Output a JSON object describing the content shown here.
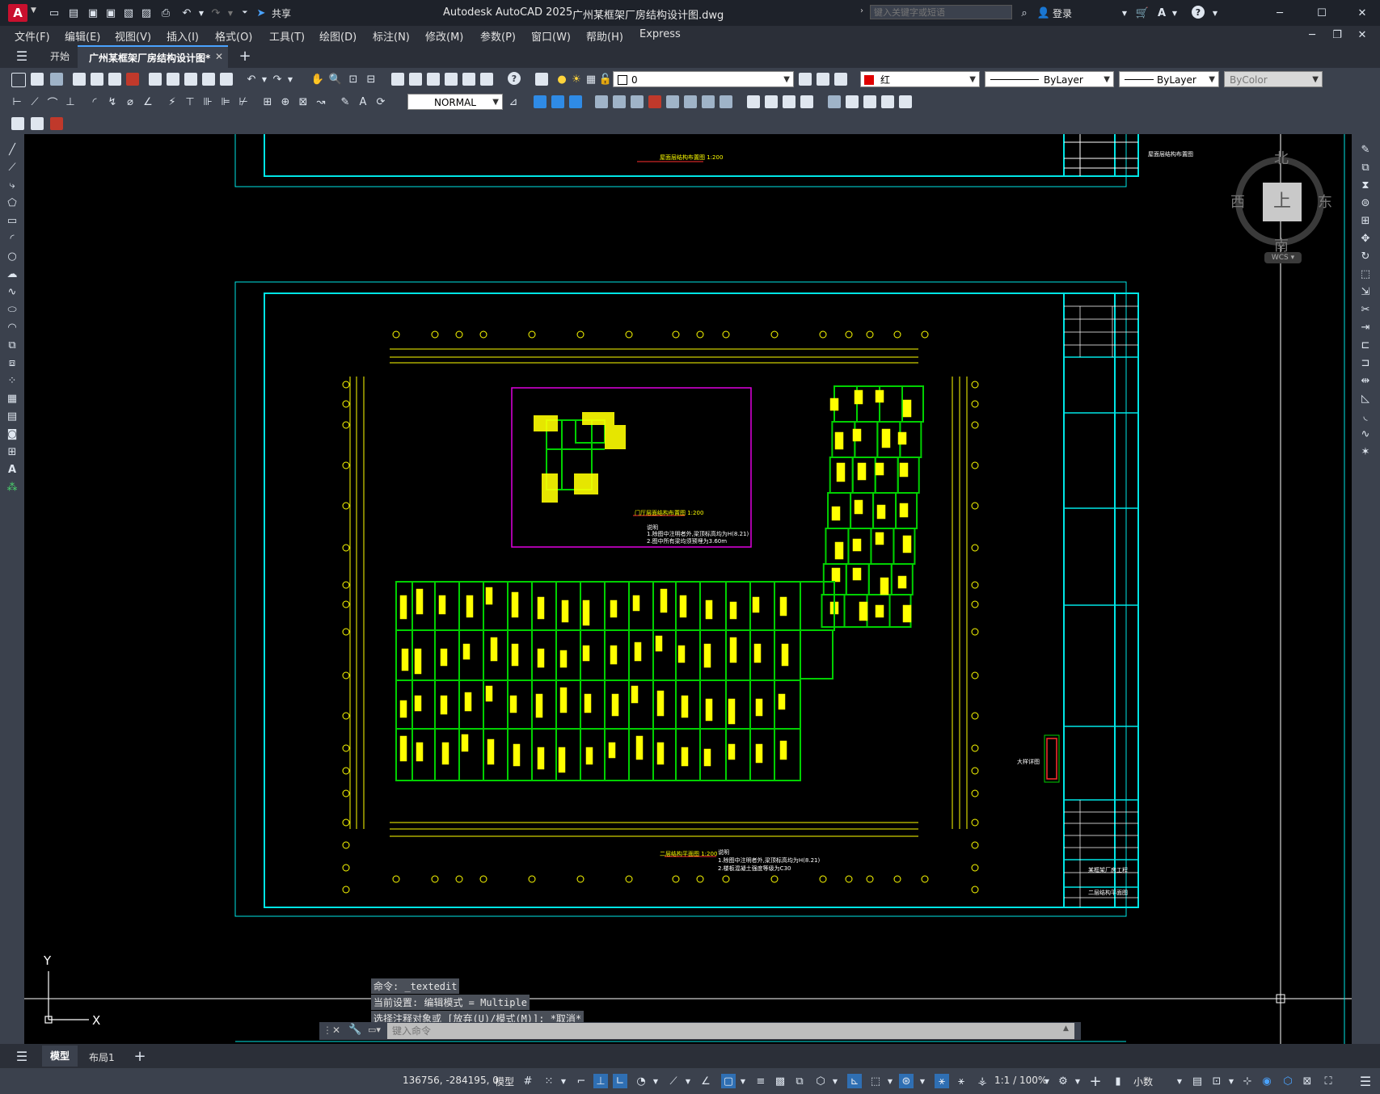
{
  "titlebar": {
    "app_title": "Autodesk AutoCAD 2025",
    "file_name": "广州某框架厂房结构设计图.dwg",
    "share_label": "共享",
    "search_placeholder": "键入关键字或短语",
    "login_label": "登录"
  },
  "menu": [
    "文件(F)",
    "编辑(E)",
    "视图(V)",
    "插入(I)",
    "格式(O)",
    "工具(T)",
    "绘图(D)",
    "标注(N)",
    "修改(M)",
    "参数(P)",
    "窗口(W)",
    "帮助(H)",
    "Express"
  ],
  "tabs": {
    "start": "开始",
    "active": "广州某框架厂房结构设计图*"
  },
  "toolbar": {
    "layer_value": "0",
    "color_value": "红",
    "linetype_value": "ByLayer",
    "lineweight_value": "ByLayer",
    "plotstyle_value": "ByColor",
    "textstyle_value": "NORMAL",
    "accent_color": "#e00000"
  },
  "viewcube": {
    "north": "北",
    "south": "南",
    "east": "东",
    "west": "西",
    "top": "上",
    "wcs": "WCS"
  },
  "drawing": {
    "top_sheet_caption": "屋面层结构布置图 1:200",
    "top_sheet_title": "屋面层结构布置图",
    "inset_caption": "门厅层面结构布置图 1:200",
    "inset_note_title": "说明",
    "inset_note_1": "1.除图中注明者外,梁顶标高均为H(8.21)",
    "inset_note_2": "2.图中所有梁均须预埋为3.60m",
    "main_caption": "二层结构平面图 1:200",
    "main_note_title": "说明",
    "main_note_1": "1.除图中注明者外,梁顶标高均为H(8.21)",
    "main_note_2": "2.楼板混凝土强度等级为C30",
    "side_label": "大样详图",
    "title_block_project": "某框架厂房工程",
    "title_block_sheet": "二层结构平面图"
  },
  "ucs": {
    "x": "X",
    "y": "Y"
  },
  "command": {
    "history": [
      "命令: _textedit",
      "当前设置: 编辑模式 = Multiple",
      "选择注释对象或 [放弃(U)/模式(M)]: *取消*"
    ],
    "placeholder": "键入命令"
  },
  "layout_tabs": [
    "模型",
    "布局1"
  ],
  "status": {
    "coords": "136756, -284195, 0",
    "space": "模型",
    "scale": "1:1 / 100%",
    "units": "小数"
  }
}
